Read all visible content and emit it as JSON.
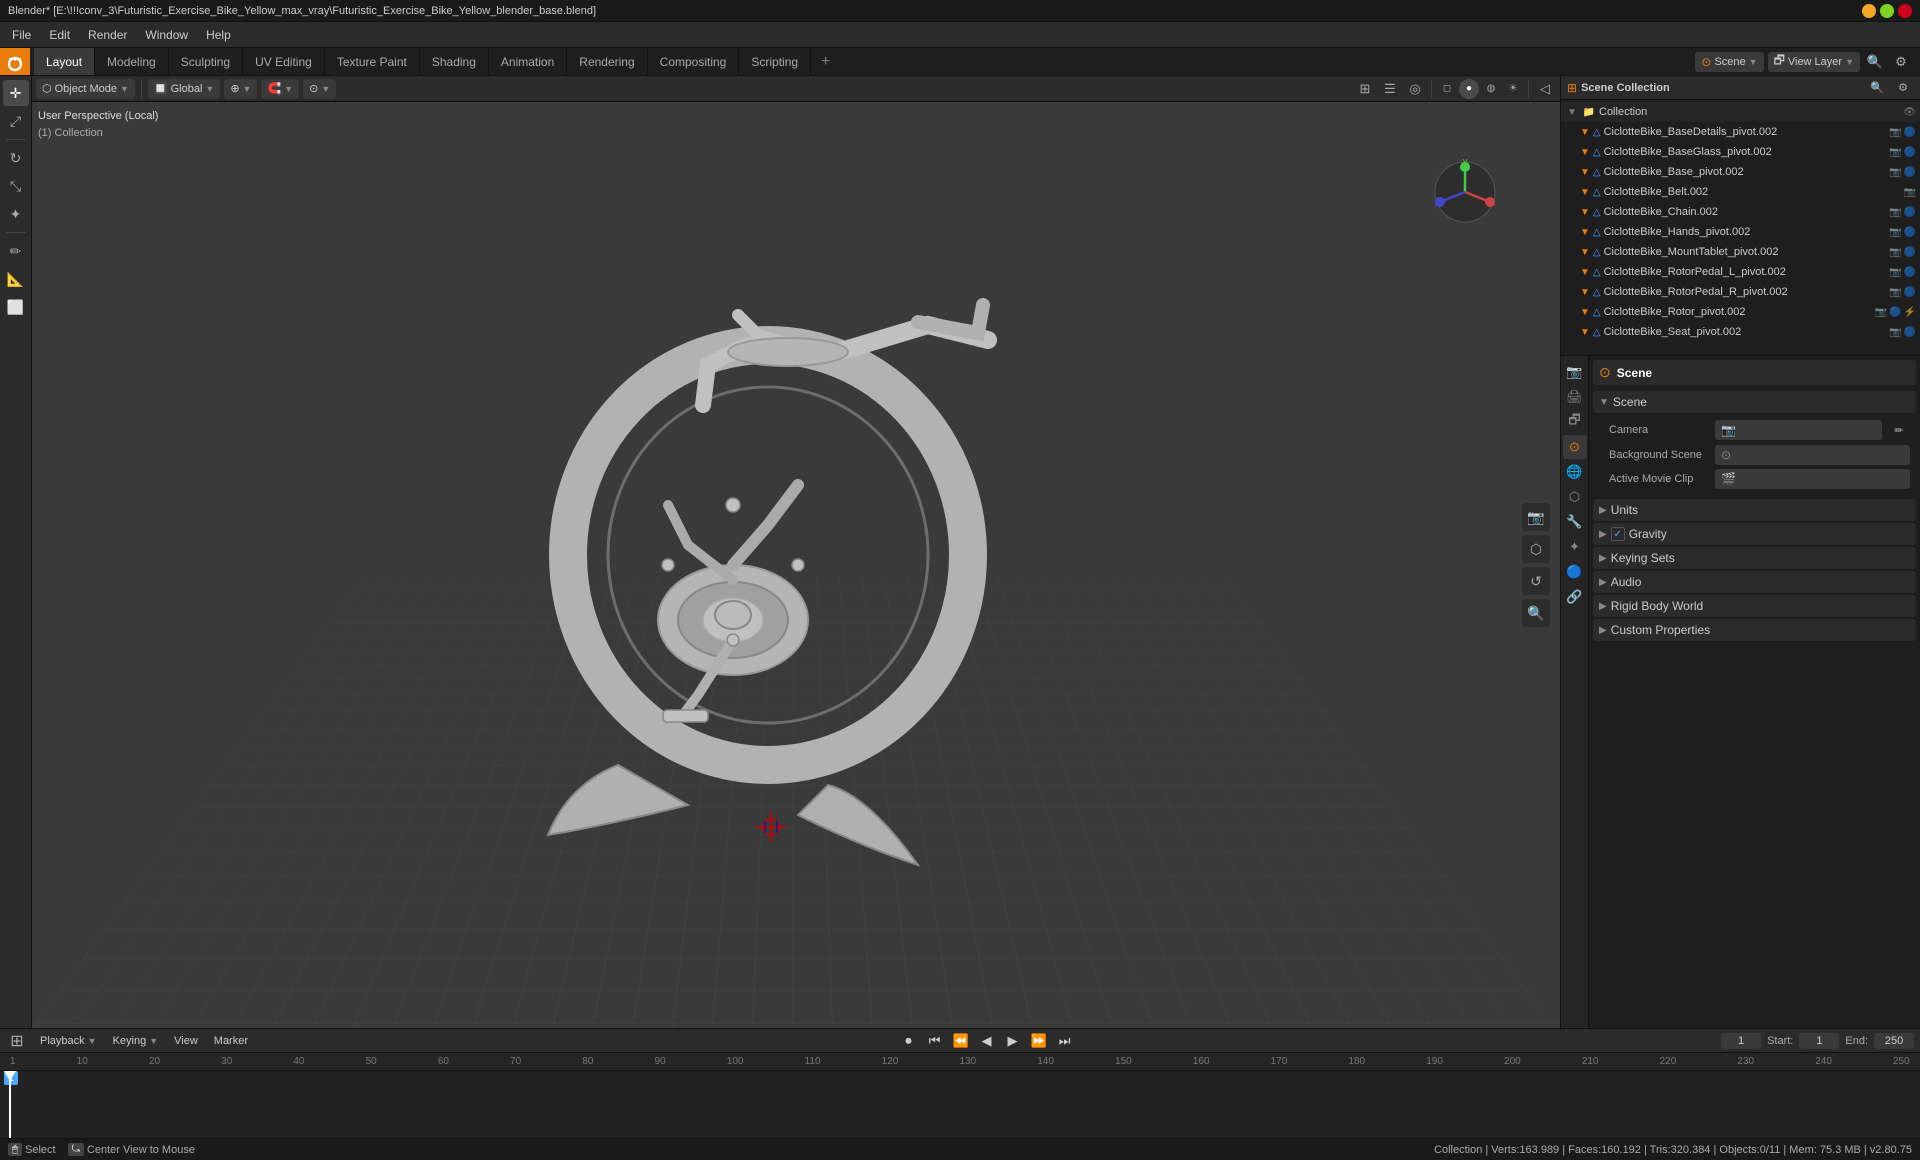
{
  "window": {
    "title": "Blender* [E:\\!!!conv_3\\Futuristic_Exercise_Bike_Yellow_max_vray\\Futuristic_Exercise_Bike_Yellow_blender_base.blend]"
  },
  "menu": {
    "items": [
      "File",
      "Edit",
      "Render",
      "Window",
      "Help"
    ]
  },
  "workspace_tabs": {
    "items": [
      "Layout",
      "Modeling",
      "Sculpting",
      "UV Editing",
      "Texture Paint",
      "Shading",
      "Animation",
      "Rendering",
      "Compositing",
      "Scripting"
    ],
    "active": "Layout",
    "scene_label": "Scene",
    "layer_label": "View Layer"
  },
  "viewport": {
    "mode": "Object Mode",
    "viewport_label": "Global",
    "info_line1": "User Perspective (Local)",
    "info_line2": "(1) Collection",
    "shading_modes": [
      "Wireframe",
      "Solid",
      "Material Preview",
      "Rendered"
    ],
    "active_shading": "Solid"
  },
  "outliner": {
    "title": "Scene Collection",
    "items": [
      {
        "label": "Collection",
        "type": "collection",
        "indent": 0,
        "has_actions": false
      },
      {
        "label": "CiclotteBike_BaseDetails_pivot.002",
        "type": "mesh",
        "indent": 1,
        "has_actions": true
      },
      {
        "label": "CiclotteBike_BaseGlass_pivot.002",
        "type": "mesh",
        "indent": 1,
        "has_actions": true
      },
      {
        "label": "CiclotteBike_Base_pivot.002",
        "type": "mesh",
        "indent": 1,
        "has_actions": true
      },
      {
        "label": "CiclotteBike_Belt.002",
        "type": "mesh",
        "indent": 1,
        "has_actions": true
      },
      {
        "label": "CiclotteBike_Chain.002",
        "type": "mesh",
        "indent": 1,
        "has_actions": true
      },
      {
        "label": "CiclotteBike_Hands_pivot.002",
        "type": "mesh",
        "indent": 1,
        "has_actions": true
      },
      {
        "label": "CiclotteBike_MountTablet_pivot.002",
        "type": "mesh",
        "indent": 1,
        "has_actions": true
      },
      {
        "label": "CiclotteBike_RotorPedal_L_pivot.002",
        "type": "mesh",
        "indent": 1,
        "has_actions": true
      },
      {
        "label": "CiclotteBike_RotorPedal_R_pivot.002",
        "type": "mesh",
        "indent": 1,
        "has_actions": true
      },
      {
        "label": "CiclotteBike_Rotor_pivot.002",
        "type": "mesh",
        "indent": 1,
        "has_actions": true
      },
      {
        "label": "CiclotteBike_Seat_pivot.002",
        "type": "mesh",
        "indent": 1,
        "has_actions": true
      }
    ]
  },
  "properties": {
    "active_tab": "scene",
    "tabs": [
      "render",
      "output",
      "view_layer",
      "scene",
      "world",
      "object",
      "modifier",
      "particles",
      "physics",
      "constraint",
      "object_data",
      "material",
      "shaderfx"
    ],
    "scene_name": "Scene",
    "sections": [
      {
        "label": "Scene",
        "expanded": true,
        "items": [
          {
            "type": "prop",
            "label": "Camera",
            "value": "",
            "has_icon": true
          },
          {
            "type": "prop",
            "label": "Background Scene",
            "value": "",
            "has_icon": true
          },
          {
            "type": "prop",
            "label": "Active Movie Clip",
            "value": "",
            "has_icon": true
          }
        ]
      },
      {
        "label": "Units",
        "expanded": false,
        "items": []
      },
      {
        "label": "Gravity",
        "expanded": false,
        "has_checkbox": true,
        "checkbox_checked": true,
        "items": []
      },
      {
        "label": "Keying Sets",
        "expanded": false,
        "items": []
      },
      {
        "label": "Audio",
        "expanded": false,
        "items": []
      },
      {
        "label": "Rigid Body World",
        "expanded": false,
        "items": []
      },
      {
        "label": "Custom Properties",
        "expanded": false,
        "items": []
      }
    ]
  },
  "timeline": {
    "header_items": [
      "Playback",
      "Keying",
      "View",
      "Marker"
    ],
    "current_frame": "1",
    "start_frame": "1",
    "end_frame": "250",
    "start_label": "Start:",
    "end_label": "End:",
    "numbers": [
      "1",
      "10",
      "20",
      "30",
      "40",
      "50",
      "60",
      "70",
      "80",
      "90",
      "100",
      "110",
      "120",
      "130",
      "140",
      "150",
      "160",
      "170",
      "180",
      "190",
      "200",
      "210",
      "220",
      "230",
      "240",
      "250"
    ]
  },
  "status_bar": {
    "select_label": "Select",
    "center_label": "Center View to Mouse",
    "stats": "Collection | Verts:163.989 | Faces:160.192 | Tris:320.384 | Objects:0/11 | Mem: 75.3 MB | v2.80.75"
  }
}
